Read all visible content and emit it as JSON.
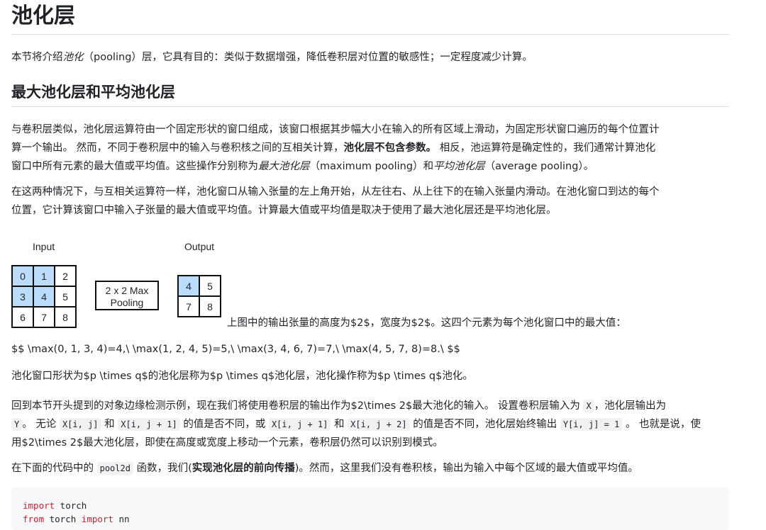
{
  "title": "池化层",
  "intro": {
    "part1": "本节将介绍",
    "term": "池化",
    "part2": "（pooling）层，它具有目的：类似于数据增强，降低卷积层对位置的敏感性；一定程度减少计算。"
  },
  "section_heading": "最大池化层和平均池化层",
  "para1": {
    "line1": "与卷积层类似，池化层运算符由一个固定形状的窗口组成，该窗口根据其步幅大小在输入的所有区域上滑动，为固定形状窗口遍历的每个位置计",
    "line2_a": "算一个输出。 然而，不同于卷积层中的输入与卷积核之间的互相关计算，",
    "line2_bold": "池化层不包含参数。",
    "line2_b": " 相反，池运算符是确定性的，我们通常计算池化",
    "line3_a": "窗口中所有元素的最大值或平均值。这些操作分别称为",
    "term_max": "最大池化层",
    "line3_b": "（maximum pooling）和",
    "term_avg": "平均池化层",
    "line3_c": "（average pooling）。"
  },
  "para2": {
    "line1": "在这两种情况下，与互相关运算符一样，池化窗口从输入张量的左上角开始，从左往右、从上往下的在输入张量内滑动。在池化窗口到达的每个",
    "line2": "位置，它计算该窗口中输入子张量的最大值或平均值。计算最大值或平均值是取决于使用了最大池化层还是平均池化层。"
  },
  "figure": {
    "input_label": "Input",
    "output_label": "Output",
    "pool_line1": "2 x 2 Max",
    "pool_line2": "Pooling",
    "input_grid": [
      [
        "0",
        "1",
        "2"
      ],
      [
        "3",
        "4",
        "5"
      ],
      [
        "6",
        "7",
        "8"
      ]
    ],
    "output_grid": [
      [
        "4",
        "5"
      ],
      [
        "7",
        "8"
      ]
    ],
    "highlight_color": "#bcdcfb",
    "caption": "上图中的输出张量的高度为$2$，宽度为$2$。这四个元素为每个池化窗口中的最大值："
  },
  "formula": "$$ \\max(0, 1, 3, 4)=4,\\ \\max(1, 2, 4, 5)=5,\\ \\max(3, 4, 6, 7)=7,\\ \\max(4, 5, 7, 8)=8.\\ $$",
  "para3": "池化窗口形状为$p \\times q$的池化层称为$p \\times q$池化层，池化操作称为$p \\times q$池化。",
  "para4": {
    "l1_a": "回到本节开头提到的对象边缘检测示例，现在我们将使用卷积层的输出作为$2\\times 2$最大池化的输入。 设置卷积层输入为",
    "code_X": "X",
    "l1_b": "，池化层输出为",
    "code_Y": "Y",
    "l2_a": "。 无论",
    "code_xij": "X[i, j]",
    "l2_b": "和",
    "code_xij1": "X[i, j + 1]",
    "l2_c": "的值是否不同，或",
    "code_xij1b": "X[i, j + 1]",
    "l2_d": "和",
    "code_xij2": "X[i, j + 2]",
    "l2_e": "的值是否不同，池化层始终输出",
    "code_yij": "Y[i, j] = 1",
    "l2_f": "。 也就是说，使",
    "l3": "用$2\\times 2$最大池化层，即使在高度或宽度上移动一个元素，卷积层仍然可以识别到模式。"
  },
  "para5": {
    "a": "在下面的代码中的",
    "code": "pool2d",
    "b": "函数，我们(",
    "bold": "实现池化层的前向传播",
    "c": ")。然而，这里我们没有卷积核，输出为输入中每个区域的最大值或平均值。"
  },
  "code_lines": [
    {
      "kw1": "import",
      "rest1": " torch",
      "kw2": "",
      "rest2": ""
    },
    {
      "kw1": "from",
      "rest1": " torch ",
      "kw2": "import",
      "rest2": " nn"
    }
  ]
}
